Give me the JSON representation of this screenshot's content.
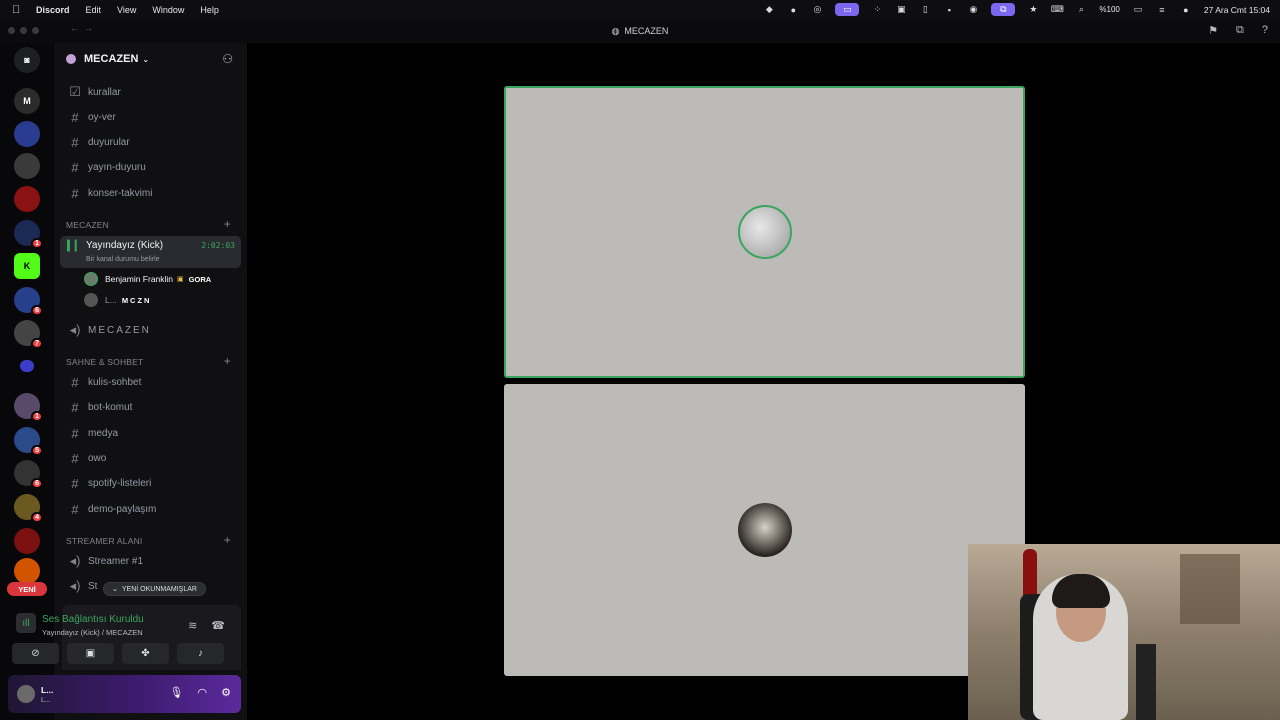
{
  "menubar": {
    "app": "Discord",
    "items": [
      "Edit",
      "View",
      "Window",
      "Help"
    ],
    "battery": "%100",
    "datetime": "27 Ara Cmt 15:04"
  },
  "window": {
    "title": "MECAZEN"
  },
  "guilds": [
    {
      "name": "discord-home-icon",
      "color": "#1e1f22"
    },
    {
      "name": "mecazen-server",
      "color": "#2b2b2b",
      "badge": ""
    },
    {
      "name": "server-2",
      "color": "#2a3c8f",
      "badge": ""
    },
    {
      "name": "server-3",
      "color": "#3a3a3a",
      "badge": ""
    },
    {
      "name": "server-4",
      "color": "#8a1212",
      "badge": ""
    },
    {
      "name": "server-5",
      "color": "#1b2a55",
      "badge": "1"
    },
    {
      "name": "kick-server",
      "color": "#53fc18",
      "badge": ""
    },
    {
      "name": "server-7",
      "color": "#27408b",
      "badge": "6"
    },
    {
      "name": "server-8",
      "color": "#444",
      "badge": "7"
    },
    {
      "name": "folder",
      "color": "#3b3cc9",
      "badge": ""
    },
    {
      "name": "server-10",
      "color": "#5a4a6a",
      "badge": "1"
    },
    {
      "name": "server-11",
      "color": "#2a4a8a",
      "badge": "5"
    },
    {
      "name": "server-12",
      "color": "#333",
      "badge": "6"
    },
    {
      "name": "server-13",
      "color": "#6a5a20",
      "badge": "4"
    },
    {
      "name": "server-14",
      "color": "#7a1010",
      "badge": ""
    },
    {
      "name": "server-15",
      "color": "#d35400",
      "badge": ""
    }
  ],
  "new_pill": "YENİ",
  "server": {
    "name": "MECAZEN",
    "channels_top": [
      "kurallar",
      "oy-ver",
      "duyurular",
      "yayın-duyuru",
      "konser-takvimi"
    ],
    "category_mecazen": "MECAZEN",
    "voice_channel": {
      "name": "Yayındayız (Kick)",
      "status": "Bir kanal durumu belirle",
      "time": "2:02:03",
      "members": [
        {
          "name": "Benjamin Franklin",
          "tag": "GORA"
        },
        {
          "name": "L...",
          "tag": "MCZN"
        }
      ]
    },
    "voice_mecazen": "MECAZEN",
    "category_sahne": "SAHNE & SOHBET",
    "channels_sahne": [
      "kulis-sohbet",
      "bot-komut",
      "medya",
      "owo",
      "spotify-listeleri",
      "demo-paylaşım"
    ],
    "category_streamer": "STREAMER ALANI",
    "streamer_channels": [
      "Streamer #1",
      "St"
    ],
    "unread_pill": "YENİ OKUNMAMIŞLAR"
  },
  "voice_panel": {
    "title": "Ses Bağlantısı Kuruldu",
    "subtitle": "Yayındayız (Kick) / MECAZEN"
  },
  "user": {
    "name": "L...",
    "status": "L..."
  },
  "stage": {
    "speaking_color": "#3ba55d"
  }
}
